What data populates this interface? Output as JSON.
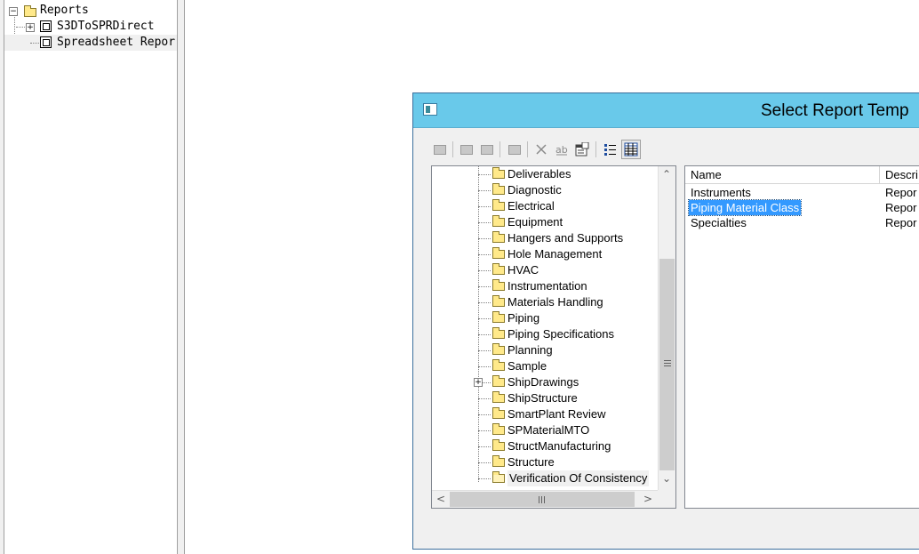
{
  "background_tree": {
    "items": [
      {
        "label": "Reports",
        "expander": "−"
      },
      {
        "label": "S3DToSPRDirect",
        "expander": "+"
      },
      {
        "label": "Spreadsheet Repor",
        "expander": ""
      }
    ]
  },
  "dialog": {
    "title": "Select Report Temp",
    "toolbar": [
      "new-folder-icon",
      "new-template-icon",
      "new-template-alt-icon",
      "save-icon",
      "delete-icon",
      "rename-icon",
      "properties-icon",
      "list-view-icon",
      "details-view-icon"
    ],
    "tree": {
      "items": [
        {
          "label": "Deliverables",
          "expandable": false,
          "open": false
        },
        {
          "label": "Diagnostic",
          "expandable": false,
          "open": false
        },
        {
          "label": "Electrical",
          "expandable": false,
          "open": false
        },
        {
          "label": "Equipment",
          "expandable": false,
          "open": false
        },
        {
          "label": "Hangers and Supports",
          "expandable": false,
          "open": false
        },
        {
          "label": "Hole Management",
          "expandable": false,
          "open": false
        },
        {
          "label": "HVAC",
          "expandable": false,
          "open": false
        },
        {
          "label": "Instrumentation",
          "expandable": false,
          "open": false
        },
        {
          "label": "Materials Handling",
          "expandable": false,
          "open": false
        },
        {
          "label": "Piping",
          "expandable": false,
          "open": false
        },
        {
          "label": "Piping Specifications",
          "expandable": false,
          "open": false
        },
        {
          "label": "Planning",
          "expandable": false,
          "open": false
        },
        {
          "label": "Sample",
          "expandable": false,
          "open": false
        },
        {
          "label": "ShipDrawings",
          "expandable": true,
          "open": false
        },
        {
          "label": "ShipStructure",
          "expandable": false,
          "open": false
        },
        {
          "label": "SmartPlant Review",
          "expandable": false,
          "open": false
        },
        {
          "label": "SPMaterialMTO",
          "expandable": false,
          "open": false
        },
        {
          "label": "StructManufacturing",
          "expandable": false,
          "open": false
        },
        {
          "label": "Structure",
          "expandable": false,
          "open": false
        },
        {
          "label": "Verification Of Consistency",
          "expandable": false,
          "open": true
        }
      ]
    },
    "list": {
      "columns": [
        "Name",
        "Descri"
      ],
      "rows": [
        {
          "name": "Instruments",
          "desc": "Repor",
          "selected": false
        },
        {
          "name": "Piping Material Class",
          "desc": "Repor",
          "selected": true
        },
        {
          "name": "Specialties",
          "desc": "Repor",
          "selected": false
        }
      ]
    }
  },
  "colors": {
    "titlebar": "#69c9ea",
    "selection": "#3399ff",
    "folder": "#ffe98a"
  }
}
